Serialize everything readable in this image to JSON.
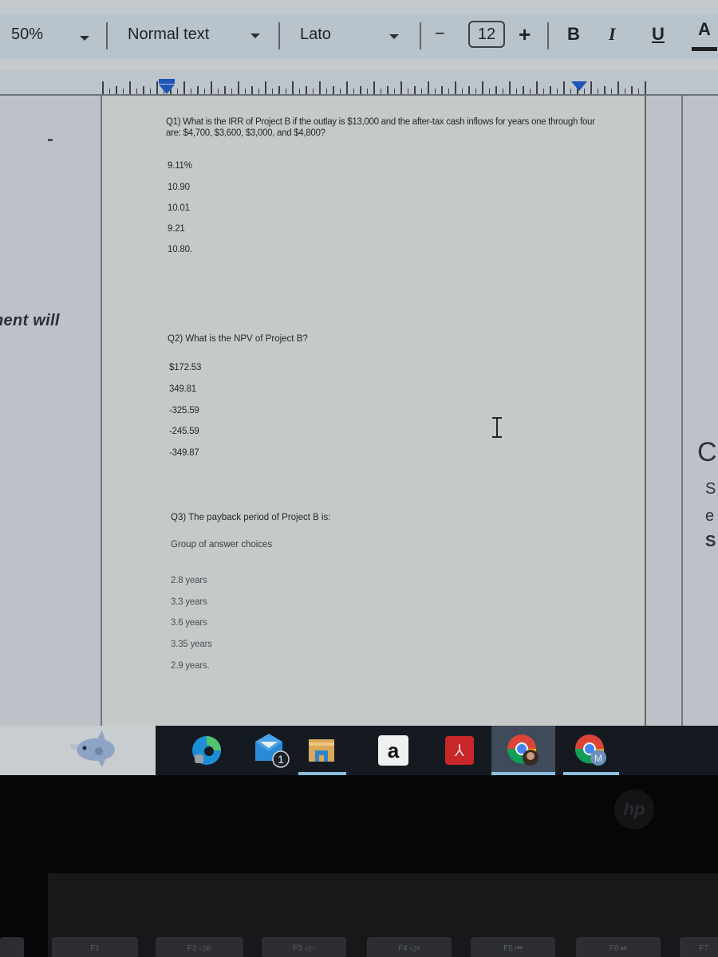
{
  "toolbar": {
    "zoom": "50%",
    "paragraph_style": "Normal text",
    "font_family": "Lato",
    "font_size": "12",
    "decrease_size": "−",
    "increase_size": "+",
    "bold": "B",
    "italic": "I",
    "underline": "U",
    "text_color": "A"
  },
  "left_margin_text": "nent will",
  "right_margin_glyphs": [
    "C",
    "S",
    "e",
    "S"
  ],
  "document": {
    "questions": [
      {
        "text": "Q1) What is the IRR of Project B if the outlay is $13,000 and the after-tax cash inflows for years one through four are: $4,700, $3,600, $3,000, and $4,800?",
        "options": [
          "9.11%",
          "10.90",
          "10.01",
          "9.21",
          "10.80."
        ]
      },
      {
        "text": "Q2) What is the NPV of Project B?",
        "options": [
          "$172.53",
          "349.81",
          "-325.59",
          "-245.59",
          "-349.87"
        ]
      },
      {
        "text": "Q3) The payback period of Project B is:",
        "subheading": "Group of answer choices",
        "options": [
          "2.8 years",
          "3.3 years",
          "3.6 years",
          "3.35 years",
          "2.9 years."
        ]
      }
    ]
  },
  "taskbar": {
    "apps": [
      {
        "name": "Widgets (sunfish)",
        "icon": "fish-icon"
      },
      {
        "name": "Microsoft Edge",
        "icon": "edge-icon"
      },
      {
        "name": "Mail",
        "icon": "mail-icon",
        "badge": "1"
      },
      {
        "name": "File Explorer",
        "icon": "folder-icon",
        "active": true
      },
      {
        "name": "Amazon",
        "icon": "amazon-icon",
        "label": "a"
      },
      {
        "name": "Adobe Acrobat",
        "icon": "acrobat-icon"
      },
      {
        "name": "Google Chrome (profile 1)",
        "icon": "chrome-icon",
        "active": true
      },
      {
        "name": "Google Chrome (profile M)",
        "icon": "chrome-icon",
        "profile": "M",
        "active": true
      }
    ]
  },
  "brand_logo": "hp",
  "keys": [
    "",
    "F1",
    "F2 ◁⊘",
    "F3 ◁−",
    "F4 ◁+",
    "F5 ⏮",
    "F6 ⏯",
    "F7"
  ],
  "colors": {
    "accent_blue": "#1e55b8",
    "taskbar_bg": "#151a21",
    "active_indicator": "#8dbfdc"
  }
}
